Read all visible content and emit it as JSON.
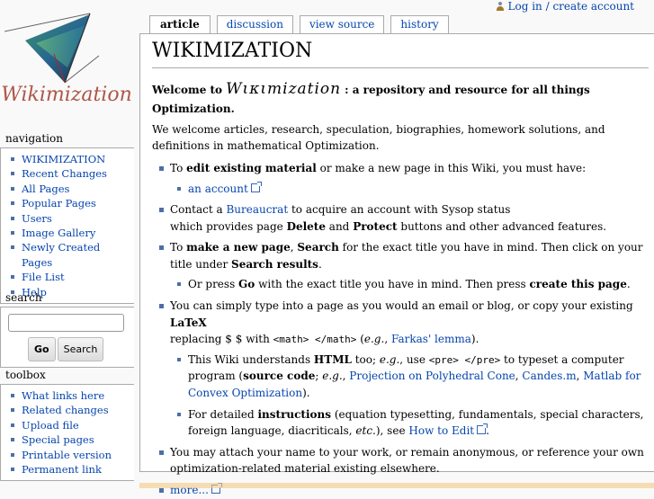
{
  "personal": {
    "login_label": "Log in / create account"
  },
  "logo": {
    "text": "Wikimization"
  },
  "tabs": [
    {
      "label": "article",
      "selected": true
    },
    {
      "label": "discussion",
      "selected": false
    },
    {
      "label": "view source",
      "selected": false
    },
    {
      "label": "history",
      "selected": false
    }
  ],
  "page": {
    "title": "WIKIMIZATION",
    "welcome_prefix": "Welcome to",
    "welcome_script": "Wικιmization",
    "welcome_suffix": ":   a repository and resource for all things Optimization.",
    "intro": "We welcome articles, research, speculation, biographies, homework solutions, and definitions in mathematical Optimization.",
    "b1_a": "To ",
    "b1_b": "edit existing material",
    "b1_c": " or make a new page in this Wiki, you must have:",
    "b1_sub": "an account",
    "b2_a": "Contact a ",
    "b2_link": "Bureaucrat",
    "b2_b": " to acquire an account with Sysop status",
    "b2_c": "which provides page ",
    "b2_d": "Delete",
    "b2_e": " and ",
    "b2_f": "Protect",
    "b2_g": " buttons and other advanced features.",
    "b3_a": "To ",
    "b3_b": "make a new page",
    "b3_c": ", ",
    "b3_d": "Search",
    "b3_e": " for the exact title you have in mind. Then click on your title under ",
    "b3_f": "Search results",
    "b3_g": ".",
    "b3_sub_a": "Or press ",
    "b3_sub_b": "Go",
    "b3_sub_c": " with the exact title you have in mind. Then press ",
    "b3_sub_d": "create this page",
    "b3_sub_e": ".",
    "b4_a": "You can simply type into a page as you would an email or blog, or copy your existing ",
    "b4_b": "LaTeX",
    "b4_c": " replacing $ $ with ",
    "b4_code": "<math> </math>",
    "b4_d": " (",
    "b4_eg": "e.g.",
    "b4_e": ", ",
    "b4_link": "Farkas' lemma",
    "b4_f": ").",
    "b4_sub1_a": "This Wiki understands ",
    "b4_sub1_b": "HTML",
    "b4_sub1_c": " too; ",
    "b4_sub1_eg": "e.g.",
    "b4_sub1_d": ", use ",
    "b4_sub1_code": "<pre> </pre>",
    "b4_sub1_e": " to typeset a computer program (",
    "b4_sub1_f": "source code",
    "b4_sub1_g": "; ",
    "b4_sub1_eg2": "e.g.",
    "b4_sub1_h": ", ",
    "b4_sub1_l1": "Projection on Polyhedral Cone",
    "b4_sub1_i": ", ",
    "b4_sub1_l2": "Candes.m",
    "b4_sub1_j": ", ",
    "b4_sub1_l3": "Matlab for Convex Optimization",
    "b4_sub1_k": ").",
    "b4_sub2_a": "For detailed ",
    "b4_sub2_b": "instructions",
    "b4_sub2_c": " (equation typesetting, fundamentals, special characters, foreign language, diacriticals, ",
    "b4_sub2_etc": "etc.",
    "b4_sub2_d": "), see ",
    "b4_sub2_link": "How to Edit",
    "b4_sub2_e": ".",
    "b5": "You may attach your name to your work, or remain anonymous, or reference your own optimization-related material existing elsewhere.",
    "b6": "more..."
  },
  "navigation": {
    "title": "navigation",
    "items": [
      "WIKIMIZATION",
      "Recent Changes",
      "All Pages",
      "Popular Pages",
      "Users",
      "Image Gallery",
      "Newly Created Pages",
      "File List",
      "Help"
    ]
  },
  "search": {
    "title": "search",
    "go_label": "Go",
    "search_label": "Search"
  },
  "toolbox": {
    "title": "toolbox",
    "items": [
      "What links here",
      "Related changes",
      "Upload file",
      "Special pages",
      "Printable version",
      "Permanent link"
    ]
  }
}
